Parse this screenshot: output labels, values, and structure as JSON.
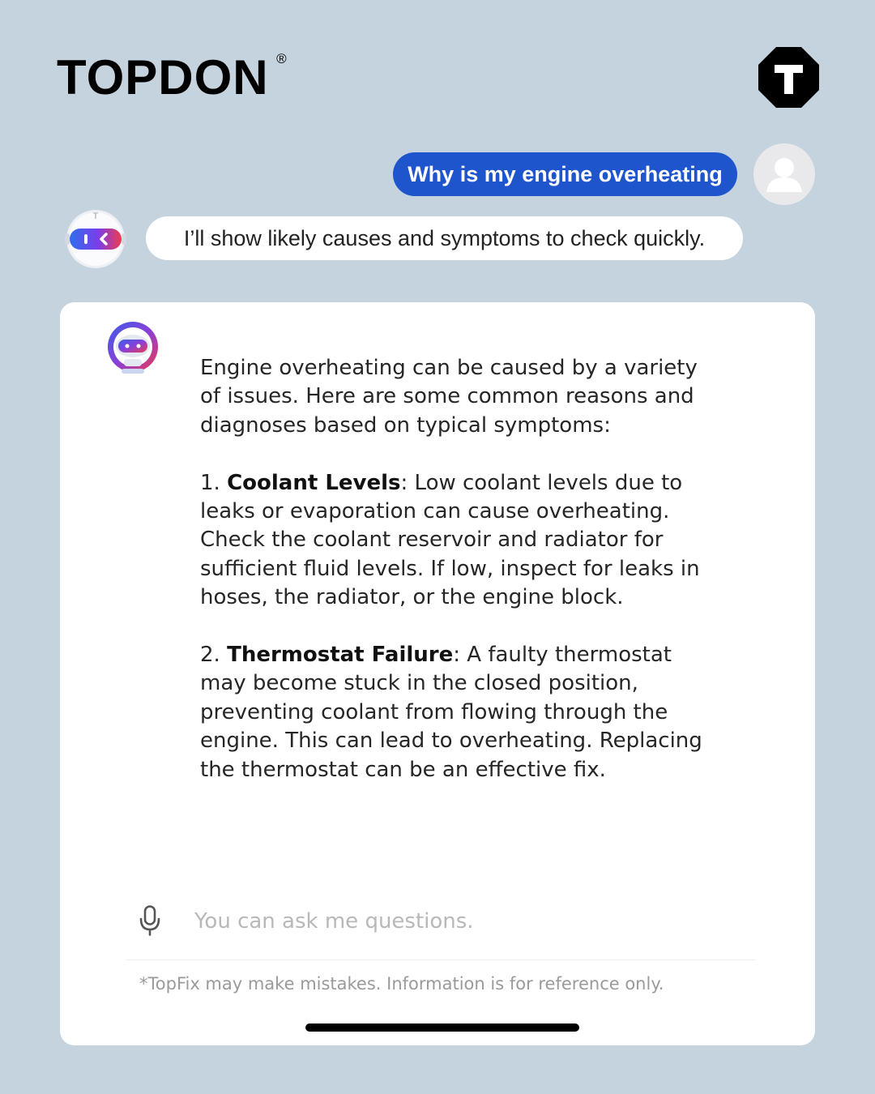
{
  "brand": {
    "name": "TOPDON",
    "registered_mark": "®",
    "badge_letter": "T"
  },
  "chat": {
    "user_message": "Why is my engine overheating",
    "bot_reply": "I’ll show likely causes and symptoms to check quickly."
  },
  "answer": {
    "intro": "Engine overheating can be caused by a variety of issues. Here are some common reasons and diagnoses based on typical symptoms:",
    "items": [
      {
        "number": "1.",
        "title": "Coolant Levels",
        "text": ": Low coolant levels due to leaks or evaporation can cause overheating. Check the coolant reservoir and radiator for sufficient fluid levels. If low, inspect for leaks in hoses, the radiator, or the engine block."
      },
      {
        "number": "2.",
        "title": "Thermostat Failure",
        "text": ": A faulty thermostat may become stuck in the closed position, preventing coolant from flowing through the engine. This can lead to overheating. Replacing the thermostat can be an effective fix."
      }
    ]
  },
  "input": {
    "placeholder": "You can ask me questions.",
    "mic_icon": "mic-icon"
  },
  "disclaimer": "*TopFix may make mistakes. Information is for reference only.",
  "colors": {
    "background": "#c5d3df",
    "user_bubble": "#1f55cc",
    "panel": "#ffffff"
  }
}
